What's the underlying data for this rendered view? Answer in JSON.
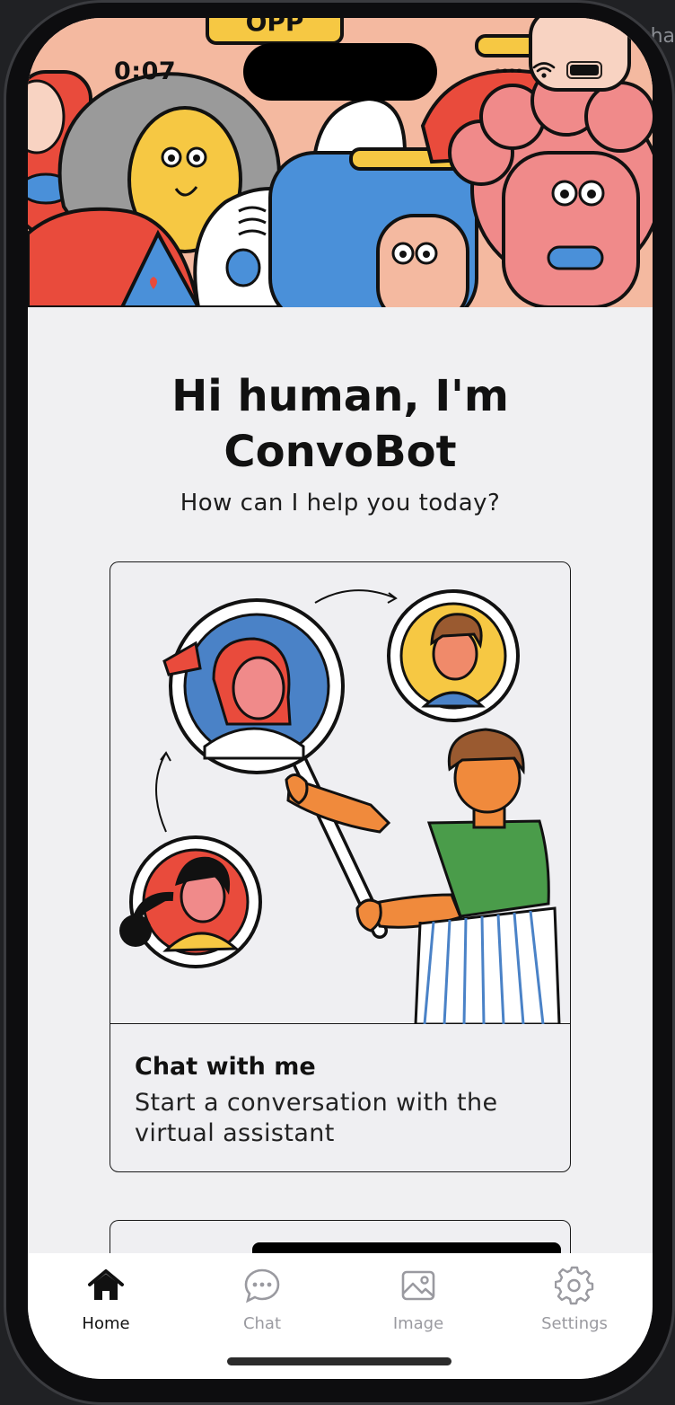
{
  "desktop": {
    "edge_text": "cha"
  },
  "status_bar": {
    "time": "0:07"
  },
  "hero": {
    "sign_text": "OPP"
  },
  "main": {
    "headline_line1": "Hi human, I'm",
    "headline_line2": "ConvoBot",
    "subheadline": "How can I help you today?"
  },
  "cards": [
    {
      "title": "Chat with me",
      "description": "Start a conversation with the virtual assistant"
    }
  ],
  "tab_bar": {
    "active": "Home",
    "items": [
      {
        "label": "Home",
        "icon": "home-icon"
      },
      {
        "label": "Chat",
        "icon": "chat-bubble-icon"
      },
      {
        "label": "Image",
        "icon": "image-icon"
      },
      {
        "label": "Settings",
        "icon": "gear-icon"
      }
    ]
  },
  "colors": {
    "background": "#f0f0f2",
    "text": "#111111",
    "tab_inactive": "#9a9aa0",
    "accent_blue": "#4a90d9",
    "accent_red": "#e94b3c",
    "accent_yellow": "#f6c843"
  }
}
